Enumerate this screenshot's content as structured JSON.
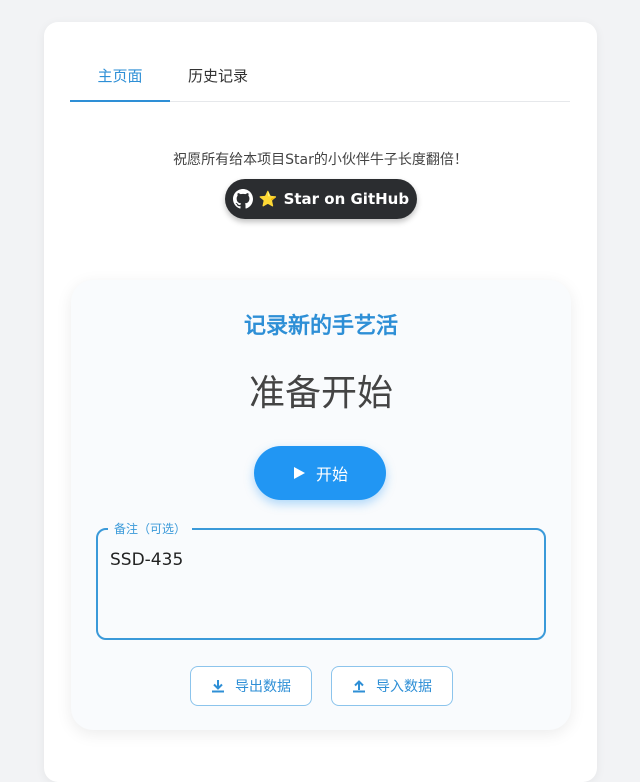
{
  "tabs": [
    {
      "label": "主页面",
      "active": true
    },
    {
      "label": "历史记录",
      "active": false
    }
  ],
  "promo": {
    "wish_text": "祝愿所有给本项目Star的小伙伴牛子长度翻倍！",
    "github_button": "Star on GitHub",
    "star_emoji": "⭐"
  },
  "recorder": {
    "title": "记录新的手艺活",
    "status": "准备开始",
    "start_label": "开始"
  },
  "note": {
    "label": "备注（可选）",
    "value": "SSD-435"
  },
  "data_actions": {
    "export_label": "导出数据",
    "import_label": "导入数据"
  },
  "colors": {
    "accent": "#2e8fd6",
    "primary_button": "#2196f3",
    "github_bg": "#2b2d30"
  }
}
